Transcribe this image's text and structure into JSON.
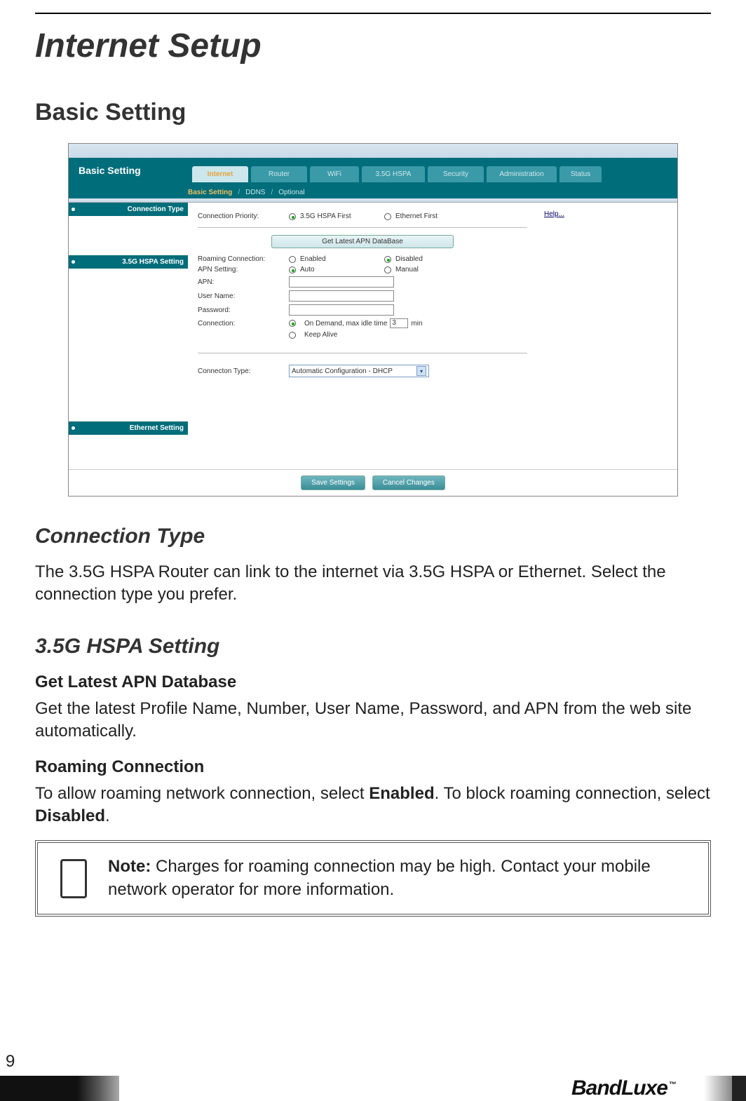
{
  "page": {
    "title": "Internet Setup",
    "section": "Basic Setting",
    "number": "9"
  },
  "screenshot": {
    "header_title": "Basic Setting",
    "tabs": {
      "internet": "Internet",
      "router": "Router",
      "wifi": "WiFi",
      "hspa": "3.5G HSPA",
      "security": "Security",
      "admin": "Administration",
      "status": "Status"
    },
    "subtabs": {
      "basic": "Basic Setting",
      "ddns": "DDNS",
      "optional": "Optional",
      "sep": "/"
    },
    "side": {
      "conn_type": "Connection Type",
      "hspa_setting": "3.5G HSPA Setting",
      "eth_setting": "Ethernet Setting"
    },
    "help": "Help...",
    "conn_priority": {
      "label": "Connection Priority:",
      "opt1": "3.5G HSPA First",
      "opt2": "Ethernet First"
    },
    "apn_button": "Get Latest APN DataBase",
    "roaming": {
      "label": "Roaming Connection:",
      "enabled": "Enabled",
      "disabled": "Disabled"
    },
    "apn_setting": {
      "label": "APN Setting:",
      "auto": "Auto",
      "manual": "Manual"
    },
    "apn": "APN:",
    "username": "User Name:",
    "password": "Password:",
    "connection": {
      "label": "Connection:",
      "ondemand_prefix": "On Demand, max idle time",
      "ondemand_value": "3",
      "ondemand_suffix": "min",
      "keepalive": "Keep Alive"
    },
    "ethernet": {
      "label": "Connecton Type:",
      "value": "Automatic Configuration - DHCP"
    },
    "buttons": {
      "save": "Save Settings",
      "cancel": "Cancel Changes"
    }
  },
  "content": {
    "h_conn_type": "Connection Type",
    "p_conn_type": "The 3.5G HSPA Router can link to the internet via 3.5G HSPA or Ethernet. Select the connection type you prefer.",
    "h_hspa": "3.5G HSPA Setting",
    "h_apn": "Get Latest APN Database",
    "p_apn": "Get the latest Profile Name, Number, User Name, Password, and APN from the web site automatically.",
    "h_roaming": "Roaming Connection",
    "p_roaming_1": "To allow roaming network connection, select ",
    "p_roaming_bold1": "Enabled",
    "p_roaming_2": ". To block roaming connection, select ",
    "p_roaming_bold2": "Disabled",
    "p_roaming_3": ".",
    "note_bold": "Note:",
    "note_text": " Charges for roaming connection may be high. Contact your mobile network operator for more information."
  },
  "footer": {
    "brand": "BandLuxe",
    "tm": "™"
  }
}
